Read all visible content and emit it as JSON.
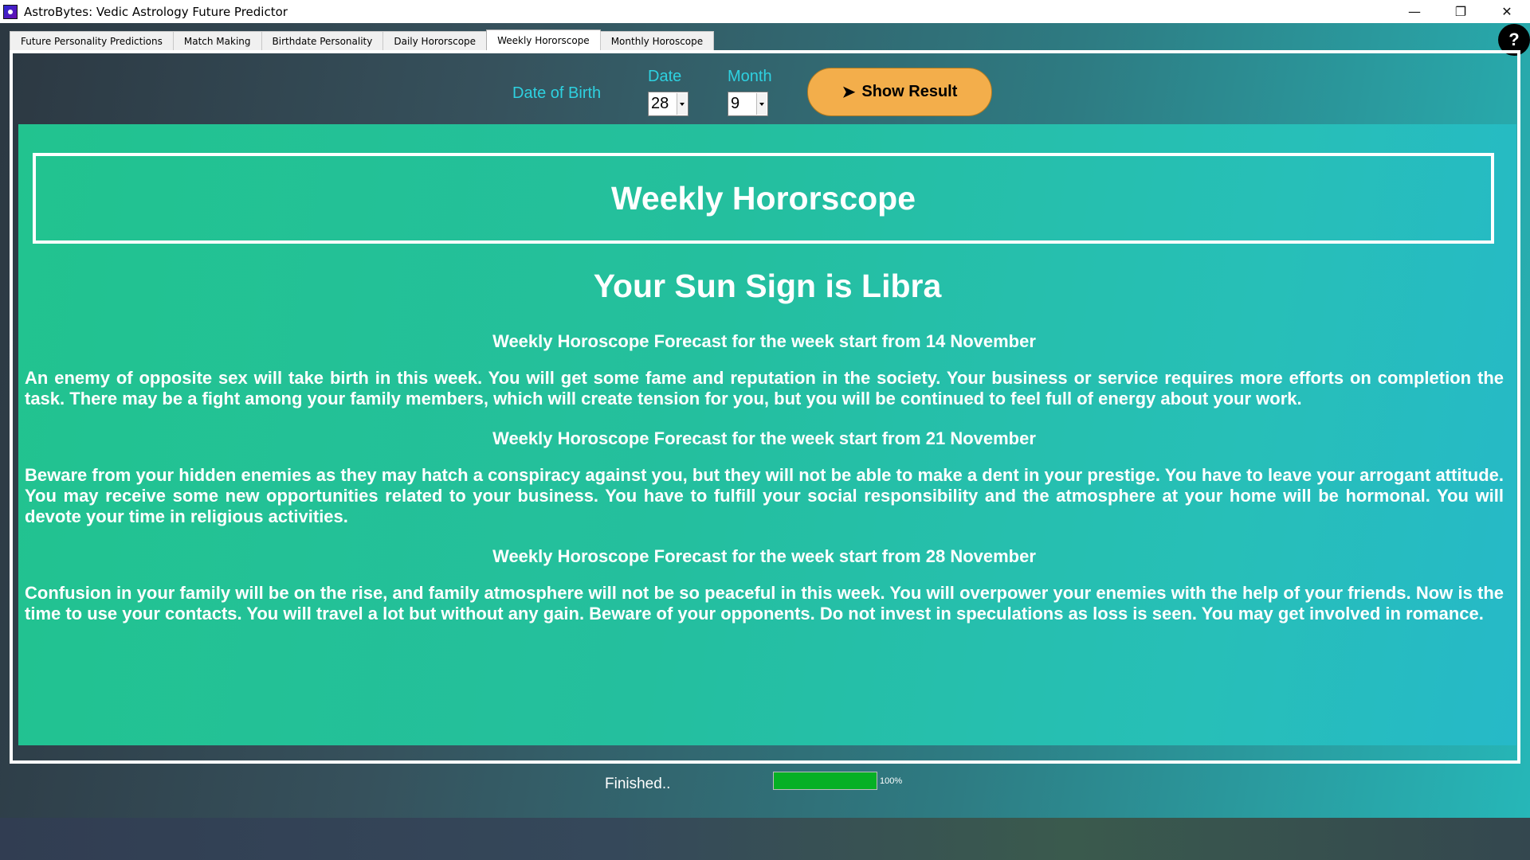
{
  "window": {
    "title": "AstroBytes: Vedic Astrology Future Predictor",
    "controls": [
      "—",
      "❐",
      "✕"
    ]
  },
  "tabs": [
    {
      "label": "Future  Personality Predictions"
    },
    {
      "label": "Match Making"
    },
    {
      "label": "Birthdate Personality"
    },
    {
      "label": "Daily Hororscope"
    },
    {
      "label": "Weekly Hororscope",
      "active": true
    },
    {
      "label": "Monthly Horoscope"
    }
  ],
  "help": {
    "label": "?"
  },
  "form": {
    "dob_label": "Date of Birth",
    "date_label": "Date",
    "date_value": "28",
    "month_label": "Month",
    "month_value": "9",
    "show_button": "Show Result",
    "show_button_icon": "arrow-right-icon"
  },
  "result": {
    "heading": "Weekly Hororscope",
    "sun_sign": "Your Sun Sign is Libra",
    "weeks": [
      {
        "title": "Weekly Horoscope Forecast for the week start from 14 November",
        "text": "An enemy of opposite sex will take birth in this week. You will get some fame and reputation in the society. Your business or service requires more efforts on completion the task. There may be a fight among your family members, which will create tension for you, but you will be continued to feel full of energy about your work."
      },
      {
        "title": "Weekly Horoscope Forecast for the week start from 21 November",
        "text": "Beware from your hidden enemies as they may hatch a conspiracy against you, but they will not be able to make a dent in your prestige. You have to leave your arrogant attitude. You may receive some new opportunities related to your business. You have to fulfill your social responsibility and the atmosphere at your home will be hormonal. You will devote your time in religious activities."
      },
      {
        "title": "Weekly Horoscope Forecast for the week start from 28 November",
        "text": "Confusion in your family will be on the rise, and family atmosphere will not be so peaceful in this week. You will overpower your enemies with the help of your friends. Now is the time to use your contacts. You will travel a lot but without any gain. Beware of your opponents. Do not invest in speculations as loss is seen. You may get involved in romance."
      }
    ]
  },
  "status": {
    "text": "Finished..",
    "progress": 100,
    "progress_label": "100%",
    "progress_color": "#06b025"
  },
  "colors": {
    "label_cyan": "#2ed1e0",
    "button_orange": "#f3ae4b",
    "result_green": "#22c38f",
    "result_teal": "#26b9c8"
  }
}
